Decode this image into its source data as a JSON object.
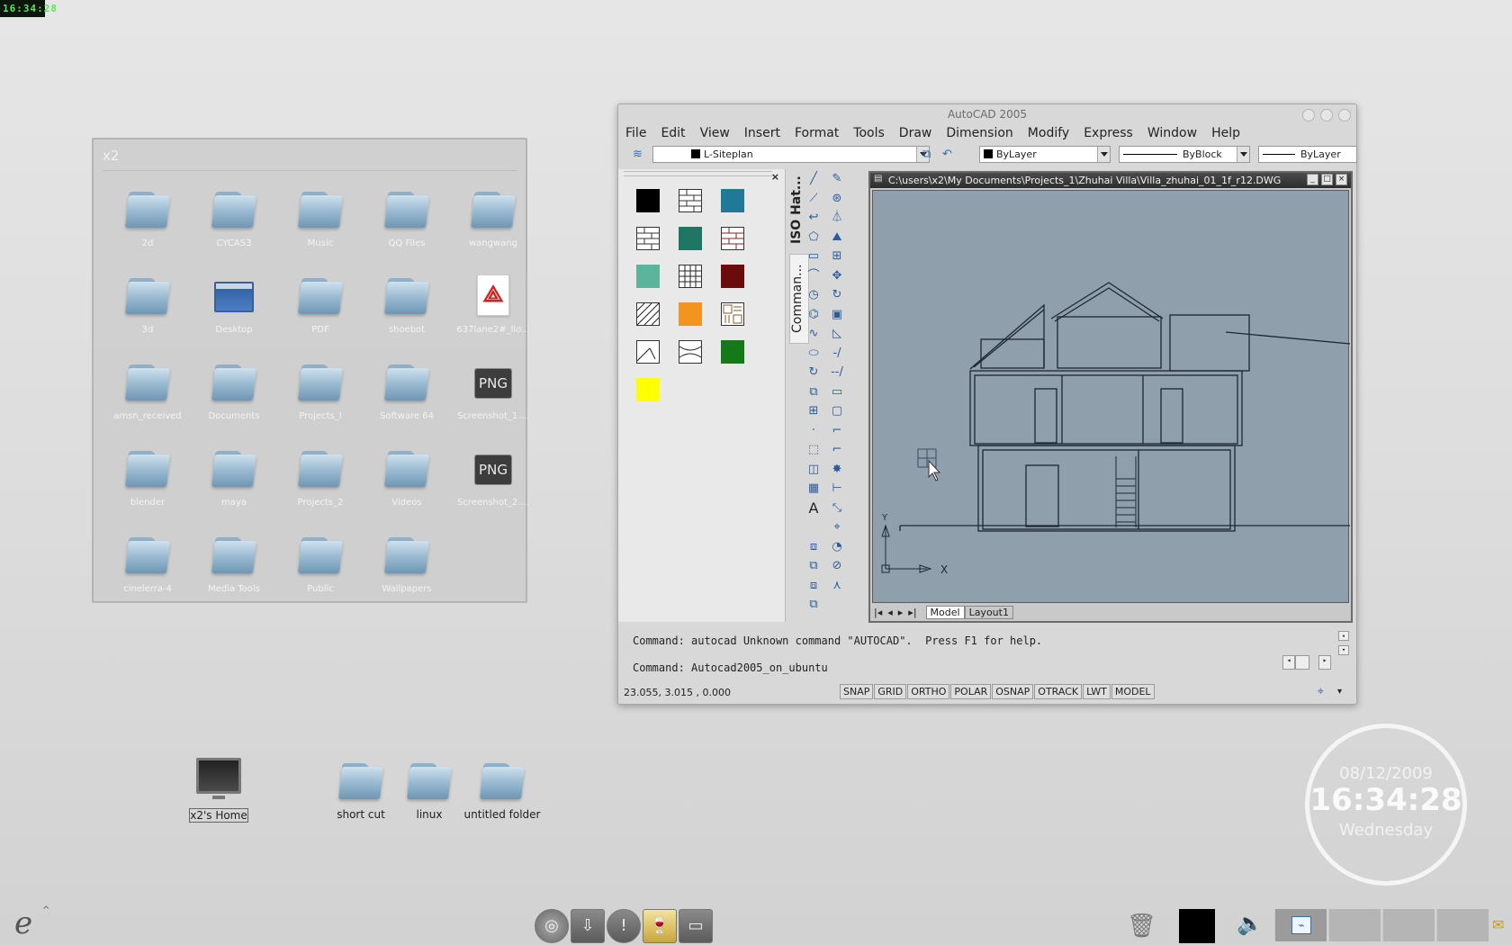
{
  "top_clock": {
    "time": "16:34:28"
  },
  "folder_window": {
    "title": "x2",
    "items": [
      {
        "label": "2d",
        "icon": "folder"
      },
      {
        "label": "CYCAS3",
        "icon": "folder"
      },
      {
        "label": "Music",
        "icon": "folder"
      },
      {
        "label": "QQ Files",
        "icon": "folder"
      },
      {
        "label": "wangwang",
        "icon": "folder"
      },
      {
        "label": "3d",
        "icon": "folder"
      },
      {
        "label": "Desktop",
        "icon": "desktop"
      },
      {
        "label": "PDF",
        "icon": "folder"
      },
      {
        "label": "shoebot",
        "icon": "folder"
      },
      {
        "label": "637lane2#_llo...",
        "icon": "pdf"
      },
      {
        "label": "amsn_received",
        "icon": "folder"
      },
      {
        "label": "Documents",
        "icon": "folder"
      },
      {
        "label": "Projects_I",
        "icon": "folder"
      },
      {
        "label": "Software 64",
        "icon": "folder"
      },
      {
        "label": "Screenshot_1....",
        "icon": "png"
      },
      {
        "label": "blender",
        "icon": "folder"
      },
      {
        "label": "maya",
        "icon": "folder"
      },
      {
        "label": "Projects_2",
        "icon": "folder"
      },
      {
        "label": "Videos",
        "icon": "folder"
      },
      {
        "label": "Screenshot_2....",
        "icon": "png"
      },
      {
        "label": "cinelerra-4",
        "icon": "folder"
      },
      {
        "label": "Media Tools",
        "icon": "folder"
      },
      {
        "label": "Public",
        "icon": "folder"
      },
      {
        "label": "Wallpapers",
        "icon": "folder"
      }
    ],
    "png_text": "PNG"
  },
  "desktop_icons": {
    "home": "x2's Home",
    "short_cut": "short cut",
    "linux": "linux",
    "untitled": "untitled folder"
  },
  "autocad": {
    "title": "AutoCAD 2005",
    "menu": [
      "File",
      "Edit",
      "View",
      "Insert",
      "Format",
      "Tools",
      "Draw",
      "Dimension",
      "Modify",
      "Express",
      "Window",
      "Help"
    ],
    "layer": "L-Siteplan",
    "color": "ByLayer",
    "linetype": "ByBlock",
    "lineweight": "ByLayer",
    "palette_tabs": [
      "ISO Hat...",
      "Comman..."
    ],
    "palette_close": "×",
    "palette_colors": [
      "#000000",
      "#1e7a96",
      "#217563",
      "#5ab59b",
      "#6b0b0b",
      "#f39420",
      "#137a17",
      "#ffff00"
    ],
    "drawing_title": "C:\\users\\x2\\My Documents\\Projects_1\\Zhuhai Villa\\Villa_zhuhai_01_1f_r12.DWG",
    "tabs": [
      "Model",
      "Layout1"
    ],
    "axis_x": "X",
    "axis_y": "Y",
    "command_lines": [
      "Command: autocad Unknown command \"AUTOCAD\".  Press F1 for help.",
      "Command: Autocad2005_on_ubuntu"
    ],
    "coords": "23.055, 3.015 , 0.000",
    "status_buttons": [
      "SNAP",
      "GRID",
      "ORTHO",
      "POLAR",
      "OSNAP",
      "OTRACK",
      "LWT",
      "MODEL"
    ]
  },
  "big_clock": {
    "date": "08/12/2009",
    "time": "16:34:28",
    "day": "Wednesday"
  }
}
